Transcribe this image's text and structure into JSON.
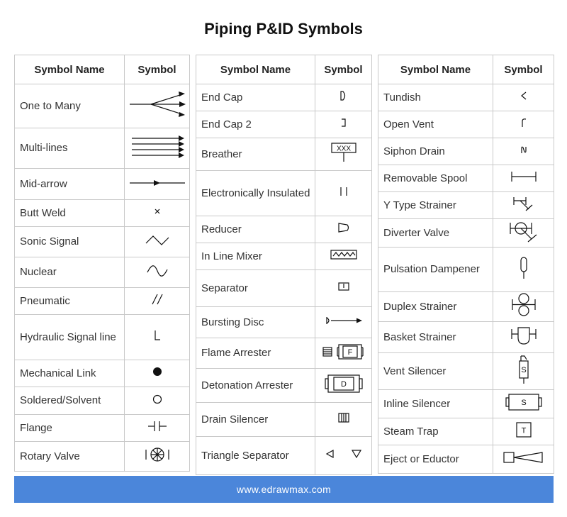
{
  "title": "Piping P&ID Symbols",
  "headers": {
    "name": "Symbol Name",
    "symbol": "Symbol"
  },
  "col1": [
    {
      "name": "One to Many",
      "icon": "one-to-many"
    },
    {
      "name": "Multi-lines",
      "icon": "multi-lines"
    },
    {
      "name": "Mid-arrow",
      "icon": "mid-arrow"
    },
    {
      "name": "Butt Weld",
      "icon": "butt-weld"
    },
    {
      "name": "Sonic Signal",
      "icon": "sonic-signal"
    },
    {
      "name": "Nuclear",
      "icon": "nuclear"
    },
    {
      "name": "Pneumatic",
      "icon": "pneumatic"
    },
    {
      "name": "Hydraulic Signal line",
      "icon": "hydraulic-signal"
    },
    {
      "name": "Mechanical Link",
      "icon": "mechanical-link"
    },
    {
      "name": "Soldered/Solvent",
      "icon": "soldered-solvent"
    },
    {
      "name": "Flange",
      "icon": "flange"
    },
    {
      "name": "Rotary Valve",
      "icon": "rotary-valve"
    }
  ],
  "col2": [
    {
      "name": "End Cap",
      "icon": "end-cap"
    },
    {
      "name": "End Cap 2",
      "icon": "end-cap-2"
    },
    {
      "name": "Breather",
      "icon": "breather",
      "text": "XXX"
    },
    {
      "name": "Electronically Insulated",
      "icon": "electronically-insulated"
    },
    {
      "name": "Reducer",
      "icon": "reducer"
    },
    {
      "name": "In Line Mixer",
      "icon": "in-line-mixer"
    },
    {
      "name": "Separator",
      "icon": "separator"
    },
    {
      "name": "Bursting Disc",
      "icon": "bursting-disc"
    },
    {
      "name": "Flame Arrester",
      "icon": "flame-arrester",
      "text": "F"
    },
    {
      "name": "Detonation Arrester",
      "icon": "detonation-arrester",
      "text": "D"
    },
    {
      "name": "Drain Silencer",
      "icon": "drain-silencer"
    },
    {
      "name": "Triangle Separator",
      "icon": "triangle-separator"
    }
  ],
  "col3": [
    {
      "name": "Tundish",
      "icon": "tundish"
    },
    {
      "name": "Open Vent",
      "icon": "open-vent"
    },
    {
      "name": "Siphon Drain",
      "icon": "siphon-drain"
    },
    {
      "name": "Removable Spool",
      "icon": "removable-spool"
    },
    {
      "name": "Y Type Strainer",
      "icon": "y-type-strainer"
    },
    {
      "name": "Diverter Valve",
      "icon": "diverter-valve"
    },
    {
      "name": "Pulsation Dampener",
      "icon": "pulsation-dampener"
    },
    {
      "name": "Duplex Strainer",
      "icon": "duplex-strainer"
    },
    {
      "name": "Basket Strainer",
      "icon": "basket-strainer"
    },
    {
      "name": "Vent Silencer",
      "icon": "vent-silencer",
      "text": "S"
    },
    {
      "name": "Inline Silencer",
      "icon": "inline-silencer",
      "text": "S"
    },
    {
      "name": "Steam Trap",
      "icon": "steam-trap",
      "text": "T"
    },
    {
      "name": "Eject or Eductor",
      "icon": "eject-eductor"
    }
  ],
  "footer": "www.edrawmax.com"
}
